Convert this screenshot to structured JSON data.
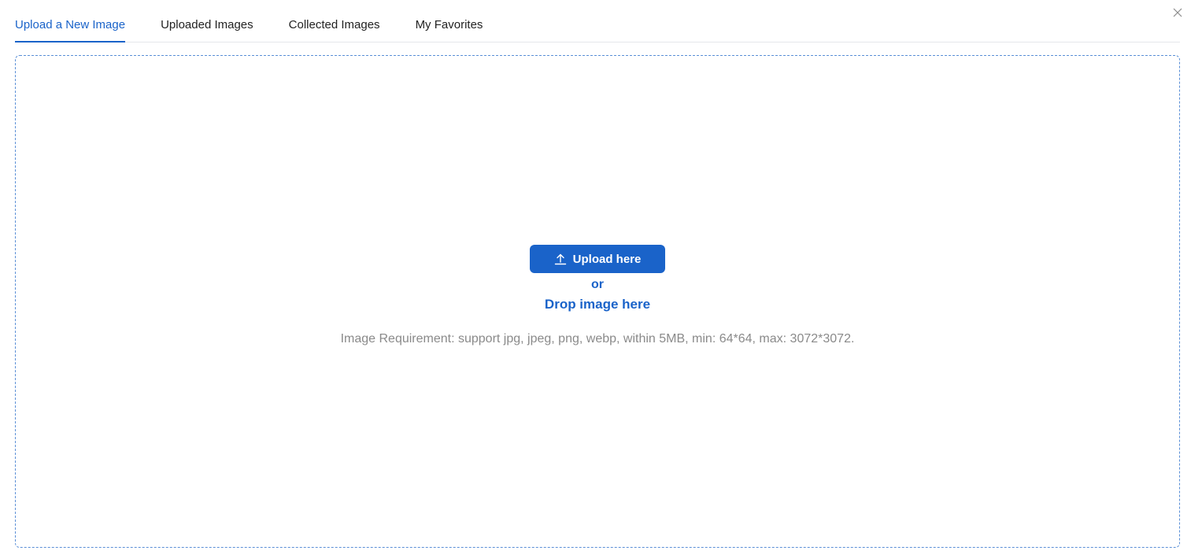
{
  "tabs": [
    {
      "label": "Upload a New Image",
      "active": true
    },
    {
      "label": "Uploaded Images",
      "active": false
    },
    {
      "label": "Collected Images",
      "active": false
    },
    {
      "label": "My Favorites",
      "active": false
    }
  ],
  "close_icon": "close-icon",
  "dropzone": {
    "upload_button_label": "Upload here",
    "upload_icon": "upload-icon",
    "or_text": "or",
    "drop_text": "Drop image here",
    "requirement_text": "Image Requirement: support jpg, jpeg, png, webp, within 5MB, min: 64*64, max: 3072*3072."
  },
  "colors": {
    "accent": "#1a63c9",
    "muted_text": "#8a8a8a",
    "dropzone_border": "#5a8fd6"
  }
}
